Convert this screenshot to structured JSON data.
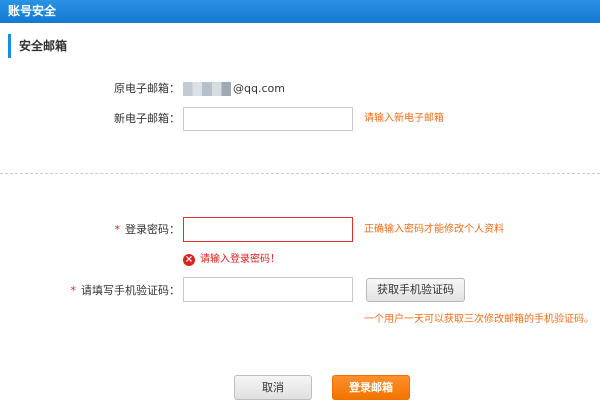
{
  "header": {
    "title": "账号安全"
  },
  "section": {
    "title": "安全邮箱"
  },
  "form": {
    "old_email": {
      "label": "原电子邮箱：",
      "value_suffix": "@qq.com"
    },
    "new_email": {
      "label": "新电子邮箱：",
      "value": "",
      "hint": "请输入新电子邮箱"
    },
    "password": {
      "required_mark": "*",
      "label": "登录密码：",
      "value": "",
      "hint": "正确输入密码才能修改个人资料",
      "error": "请输入登录密码！"
    },
    "sms_code": {
      "required_mark": "*",
      "label": "请填写手机验证码：",
      "value": "",
      "button": "获取手机验证码",
      "hint": "一个用户一天可以获取三次修改邮箱的手机验证码。"
    }
  },
  "actions": {
    "cancel": "取消",
    "submit": "登录邮箱"
  },
  "colors": {
    "header": "#1a86dc",
    "hint": "#f06d19",
    "error": "#e02020",
    "submit": "#f27400"
  },
  "icons": {
    "error": "error-circle-icon"
  }
}
